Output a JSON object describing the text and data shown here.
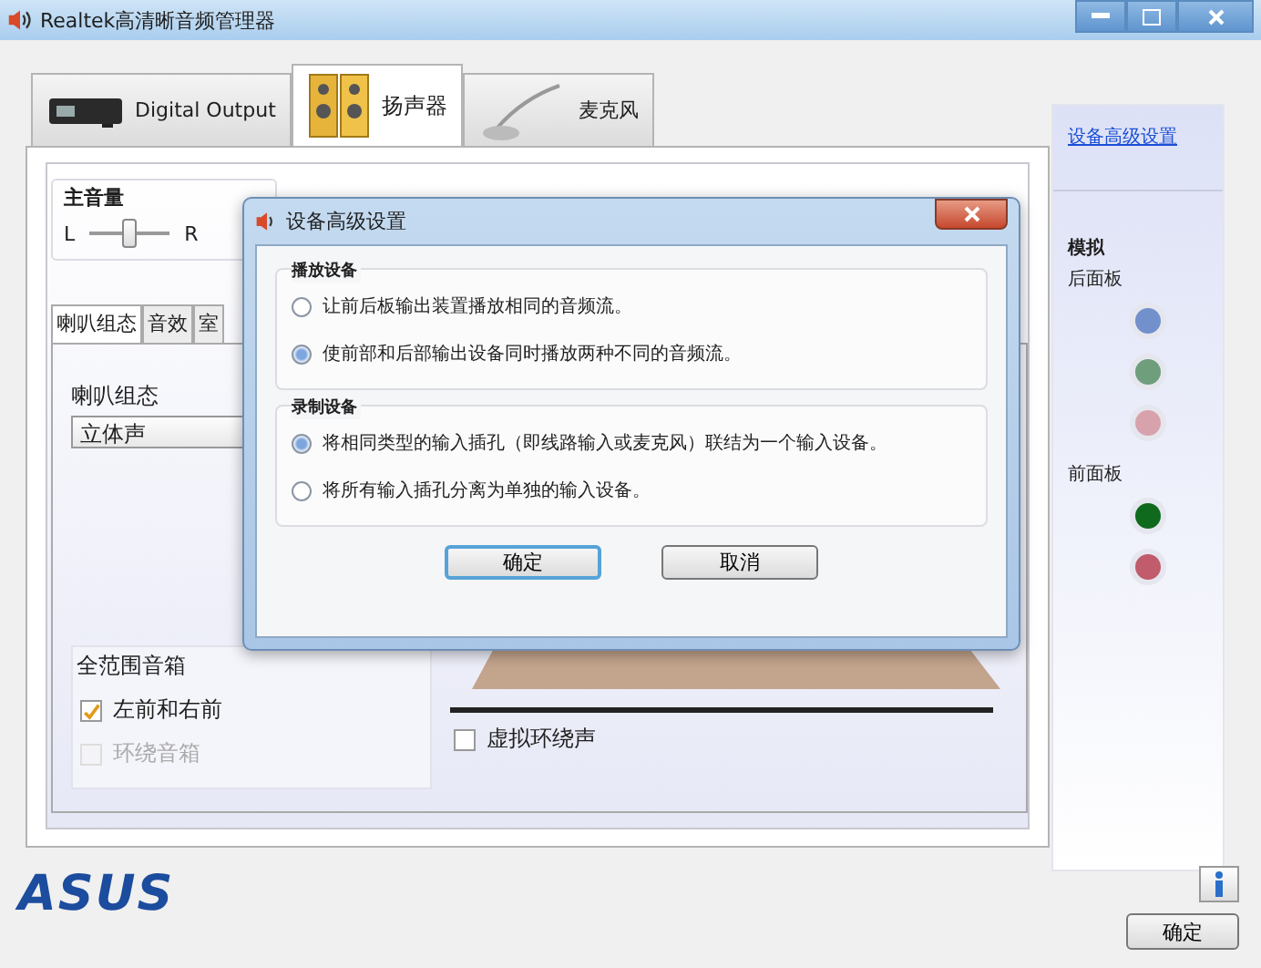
{
  "window": {
    "title": "Realtek高清晰音频管理器"
  },
  "device_tabs": [
    {
      "label": "Digital Output",
      "selected": false,
      "kind": "digital"
    },
    {
      "label": "扬声器",
      "selected": true,
      "kind": "speaker"
    },
    {
      "label": "麦克风",
      "selected": false,
      "kind": "mic"
    }
  ],
  "main_volume": {
    "label": "主音量",
    "left": "L",
    "right": "R",
    "level": 0.5
  },
  "sub_tabs": [
    {
      "label": "喇叭组态",
      "selected": true
    },
    {
      "label": "音效",
      "selected": false
    },
    {
      "label": "室",
      "selected": false
    }
  ],
  "speaker_config": {
    "label": "喇叭组态",
    "value": "立体声"
  },
  "full_range": {
    "label": "全范围音箱",
    "options": [
      {
        "label": "左前和右前",
        "checked": true,
        "disabled": false
      },
      {
        "label": "环绕音箱",
        "checked": false,
        "disabled": true
      }
    ]
  },
  "virtual_surround": {
    "label": "虚拟环绕声",
    "checked": false
  },
  "sidebar": {
    "link": "设备高级设置",
    "section": "模拟",
    "panels": [
      {
        "label": "后面板",
        "jacks": [
          {
            "color": "#7290cc"
          },
          {
            "color": "#6f9e7c"
          },
          {
            "color": "#d8a2ad"
          }
        ]
      },
      {
        "label": "前面板",
        "jacks": [
          {
            "color": "#0f6a1e"
          },
          {
            "color": "#c05c6c"
          }
        ]
      }
    ]
  },
  "logo": "ASUS",
  "ok_button": "确定",
  "dialog": {
    "title": "设备高级设置",
    "groups": [
      {
        "title": "播放设备",
        "options": [
          {
            "label": "让前后板输出装置播放相同的音频流。",
            "selected": false
          },
          {
            "label": "使前部和后部输出设备同时播放两种不同的音频流。",
            "selected": true
          }
        ]
      },
      {
        "title": "录制设备",
        "options": [
          {
            "label": "将相同类型的输入插孔（即线路输入或麦克风）联结为一个输入设备。",
            "selected": true
          },
          {
            "label": "将所有输入插孔分离为单独的输入设备。",
            "selected": false
          }
        ]
      }
    ],
    "buttons": [
      {
        "label": "确定",
        "default": true
      },
      {
        "label": "取消",
        "default": false
      }
    ]
  }
}
